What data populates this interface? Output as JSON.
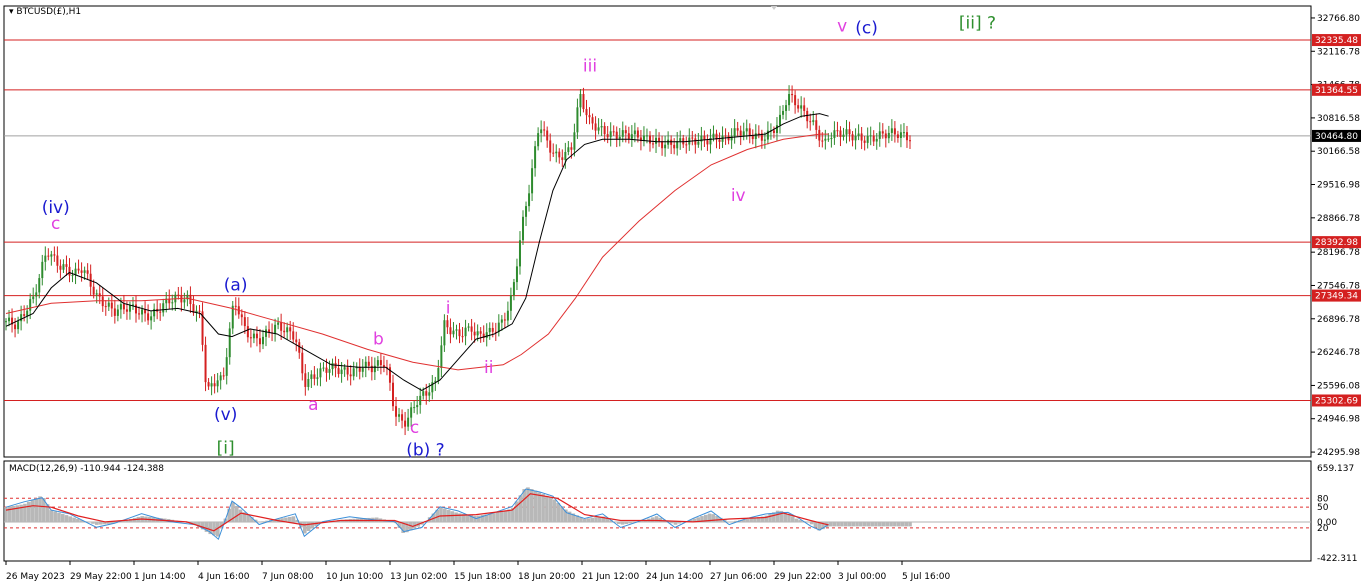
{
  "symbol": "BTCUSD(£),H1",
  "macd_label": "MACD(12,26,9) -110.944 -124.388",
  "colors": {
    "bull_candle": "#2e8b2e",
    "bear_candle": "#d42020",
    "ma_fast": "#000000",
    "ma_slow": "#e03030",
    "hline": "#d42020",
    "current": "#a0a0a0",
    "macd_hist": "#b8b8b8",
    "macd_line": "#3b8fd9",
    "macd_signal": "#e02020",
    "magenta": "#e040e0",
    "blue": "#1a1ad0",
    "green": "#2d8f2d"
  },
  "chart_data": [
    {
      "type": "line",
      "title": "BTCUSD(£),H1",
      "ylim": [
        24200,
        33000
      ],
      "price_ticks": [
        "32766.80",
        "32116.78",
        "31466.78",
        "30816.58",
        "30166.58",
        "29516.98",
        "28866.78",
        "28196.78",
        "27546.78",
        "26896.78",
        "26246.78",
        "25596.08",
        "24946.98",
        "24295.98"
      ],
      "x_ticks": [
        "26 May 2023",
        "29 May 22:00",
        "1 Jun 14:00",
        "4 Jun 16:00",
        "7 Jun 08:00",
        "10 Jun 10:00",
        "13 Jun 02:00",
        "15 Jun 18:00",
        "18 Jun 20:00",
        "21 Jun 12:00",
        "24 Jun 14:00",
        "27 Jun 06:00",
        "29 Jun 22:00",
        "3 Jul 00:00",
        "5 Jul 16:00"
      ],
      "hlines": [
        {
          "label": "32335.48",
          "value": 32335.48
        },
        {
          "label": "31364.55",
          "value": 31364.55
        },
        {
          "label": "28392.98",
          "value": 28392.98
        },
        {
          "label": "27349.34",
          "value": 27349.34
        },
        {
          "label": "25302.69",
          "value": 25302.69
        }
      ],
      "current": {
        "label": "30464.80",
        "value": 30464.8
      },
      "path_points": [
        [
          0,
          26850
        ],
        [
          0.012,
          26700
        ],
        [
          0.03,
          27300
        ],
        [
          0.045,
          28300
        ],
        [
          0.06,
          27900
        ],
        [
          0.075,
          27700
        ],
        [
          0.085,
          27900
        ],
        [
          0.1,
          27400
        ],
        [
          0.12,
          27000
        ],
        [
          0.14,
          27100
        ],
        [
          0.16,
          27000
        ],
        [
          0.18,
          27200
        ],
        [
          0.2,
          27300
        ],
        [
          0.215,
          27000
        ],
        [
          0.222,
          25500
        ],
        [
          0.235,
          25700
        ],
        [
          0.24,
          25600
        ],
        [
          0.25,
          27000
        ],
        [
          0.255,
          27200
        ],
        [
          0.265,
          26700
        ],
        [
          0.28,
          26500
        ],
        [
          0.3,
          26700
        ],
        [
          0.32,
          26600
        ],
        [
          0.33,
          25700
        ],
        [
          0.345,
          25800
        ],
        [
          0.36,
          25900
        ],
        [
          0.38,
          25900
        ],
        [
          0.395,
          26000
        ],
        [
          0.405,
          25900
        ],
        [
          0.42,
          26000
        ],
        [
          0.43,
          25100
        ],
        [
          0.44,
          24900
        ],
        [
          0.455,
          25300
        ],
        [
          0.465,
          25400
        ],
        [
          0.475,
          25600
        ],
        [
          0.485,
          26800
        ],
        [
          0.5,
          26650
        ],
        [
          0.515,
          26700
        ],
        [
          0.52,
          26500
        ],
        [
          0.535,
          26600
        ],
        [
          0.55,
          26900
        ],
        [
          0.56,
          27400
        ],
        [
          0.57,
          28600
        ],
        [
          0.58,
          29500
        ],
        [
          0.59,
          30700
        ],
        [
          0.6,
          30300
        ],
        [
          0.61,
          30100
        ],
        [
          0.625,
          30200
        ],
        [
          0.635,
          31200
        ],
        [
          0.645,
          30700
        ],
        [
          0.66,
          30600
        ],
        [
          0.68,
          30500
        ],
        [
          0.7,
          30400
        ],
        [
          0.72,
          30400
        ],
        [
          0.74,
          30300
        ],
        [
          0.755,
          30300
        ],
        [
          0.77,
          30400
        ],
        [
          0.785,
          30500
        ],
        [
          0.795,
          30400
        ],
        [
          0.81,
          30500
        ],
        [
          0.825,
          30500
        ],
        [
          0.84,
          30500
        ],
        [
          0.855,
          30700
        ],
        [
          0.865,
          31200
        ],
        [
          0.875,
          31050
        ],
        [
          0.885,
          30900
        ],
        [
          0.895,
          30700
        ],
        [
          0.905,
          30300
        ],
        [
          0.91,
          30464
        ]
      ],
      "ma_fast": [
        [
          0,
          26750
        ],
        [
          0.03,
          27000
        ],
        [
          0.05,
          27500
        ],
        [
          0.07,
          27800
        ],
        [
          0.1,
          27600
        ],
        [
          0.13,
          27200
        ],
        [
          0.16,
          27050
        ],
        [
          0.19,
          27100
        ],
        [
          0.215,
          27000
        ],
        [
          0.235,
          26600
        ],
        [
          0.25,
          26550
        ],
        [
          0.27,
          26700
        ],
        [
          0.3,
          26600
        ],
        [
          0.33,
          26300
        ],
        [
          0.36,
          26000
        ],
        [
          0.39,
          25950
        ],
        [
          0.42,
          25950
        ],
        [
          0.44,
          25700
        ],
        [
          0.46,
          25500
        ],
        [
          0.48,
          25700
        ],
        [
          0.5,
          26100
        ],
        [
          0.52,
          26500
        ],
        [
          0.54,
          26600
        ],
        [
          0.56,
          26800
        ],
        [
          0.575,
          27300
        ],
        [
          0.59,
          28400
        ],
        [
          0.605,
          29400
        ],
        [
          0.62,
          30000
        ],
        [
          0.64,
          30300
        ],
        [
          0.66,
          30400
        ],
        [
          0.69,
          30400
        ],
        [
          0.72,
          30350
        ],
        [
          0.75,
          30350
        ],
        [
          0.78,
          30400
        ],
        [
          0.81,
          30450
        ],
        [
          0.84,
          30500
        ],
        [
          0.86,
          30700
        ],
        [
          0.88,
          30850
        ],
        [
          0.9,
          30900
        ],
        [
          0.91,
          30850
        ]
      ],
      "ma_slow": [
        [
          0,
          27000
        ],
        [
          0.05,
          27200
        ],
        [
          0.1,
          27250
        ],
        [
          0.15,
          27250
        ],
        [
          0.2,
          27300
        ],
        [
          0.25,
          27100
        ],
        [
          0.3,
          26850
        ],
        [
          0.35,
          26600
        ],
        [
          0.4,
          26300
        ],
        [
          0.45,
          26050
        ],
        [
          0.5,
          25900
        ],
        [
          0.55,
          26000
        ],
        [
          0.57,
          26200
        ],
        [
          0.6,
          26600
        ],
        [
          0.63,
          27300
        ],
        [
          0.66,
          28100
        ],
        [
          0.7,
          28800
        ],
        [
          0.74,
          29400
        ],
        [
          0.78,
          29900
        ],
        [
          0.82,
          30200
        ],
        [
          0.86,
          30400
        ],
        [
          0.9,
          30500
        ],
        [
          0.91,
          30500
        ]
      ],
      "labels": [
        {
          "text": "(iv)",
          "x": 0.055,
          "v": 28960,
          "color": "blue"
        },
        {
          "text": "c",
          "x": 0.055,
          "v": 28650,
          "color": "magenta"
        },
        {
          "text": "(a)",
          "x": 0.254,
          "v": 27450,
          "color": "blue"
        },
        {
          "text": "(v)",
          "x": 0.243,
          "v": 24920,
          "color": "blue"
        },
        {
          "text": "[i]",
          "x": 0.243,
          "v": 24270,
          "color": "green"
        },
        {
          "text": "a",
          "x": 0.34,
          "v": 25120,
          "color": "magenta"
        },
        {
          "text": "b",
          "x": 0.412,
          "v": 26400,
          "color": "magenta"
        },
        {
          "text": "c",
          "x": 0.452,
          "v": 24670,
          "color": "magenta"
        },
        {
          "text": "(b) ?",
          "x": 0.464,
          "v": 24230,
          "color": "blue"
        },
        {
          "text": "i",
          "x": 0.489,
          "v": 27000,
          "color": "magenta"
        },
        {
          "text": "ii",
          "x": 0.534,
          "v": 25840,
          "color": "magenta"
        },
        {
          "text": "iii",
          "x": 0.646,
          "v": 31720,
          "color": "magenta"
        },
        {
          "text": "iv",
          "x": 0.81,
          "v": 29200,
          "color": "magenta"
        },
        {
          "text": "v",
          "x": 0.925,
          "v": 32500,
          "color": "magenta"
        },
        {
          "text": "(c)",
          "x": 0.952,
          "v": 32460,
          "color": "blue"
        },
        {
          "text": "[ii] ?",
          "x": 1.0,
          "v": 32560,
          "color": "green"
        }
      ]
    },
    {
      "type": "line",
      "title": "MACD(12,26,9) -110.944 -124.388",
      "ylim": [
        -422.311,
        659.137
      ],
      "ticks": [
        "659.137",
        "80",
        "50",
        "0.00",
        "20",
        "-422.311"
      ],
      "levels": [
        80,
        50,
        0,
        -20
      ],
      "macd_line": [
        [
          0,
          50
        ],
        [
          0.02,
          60
        ],
        [
          0.04,
          90
        ],
        [
          0.05,
          40
        ],
        [
          0.07,
          20
        ],
        [
          0.1,
          -10
        ],
        [
          0.12,
          -5
        ],
        [
          0.15,
          20
        ],
        [
          0.18,
          10
        ],
        [
          0.21,
          -10
        ],
        [
          0.225,
          -40
        ],
        [
          0.235,
          -50
        ],
        [
          0.25,
          70
        ],
        [
          0.26,
          40
        ],
        [
          0.28,
          0
        ],
        [
          0.3,
          10
        ],
        [
          0.32,
          20
        ],
        [
          0.33,
          -40
        ],
        [
          0.35,
          0
        ],
        [
          0.38,
          10
        ],
        [
          0.41,
          15
        ],
        [
          0.43,
          0
        ],
        [
          0.44,
          -40
        ],
        [
          0.46,
          -10
        ],
        [
          0.48,
          50
        ],
        [
          0.5,
          30
        ],
        [
          0.52,
          20
        ],
        [
          0.54,
          30
        ],
        [
          0.56,
          45
        ],
        [
          0.575,
          120
        ],
        [
          0.59,
          100
        ],
        [
          0.605,
          80
        ],
        [
          0.62,
          40
        ],
        [
          0.64,
          10
        ],
        [
          0.66,
          20
        ],
        [
          0.68,
          -10
        ],
        [
          0.7,
          0
        ],
        [
          0.72,
          20
        ],
        [
          0.74,
          -10
        ],
        [
          0.76,
          10
        ],
        [
          0.78,
          30
        ],
        [
          0.8,
          0
        ],
        [
          0.82,
          10
        ],
        [
          0.84,
          20
        ],
        [
          0.855,
          40
        ],
        [
          0.865,
          30
        ],
        [
          0.875,
          10
        ],
        [
          0.89,
          -5
        ],
        [
          0.9,
          -30
        ],
        [
          0.91,
          -15
        ]
      ],
      "macd_signal": [
        [
          0,
          40
        ],
        [
          0.03,
          55
        ],
        [
          0.05,
          50
        ],
        [
          0.08,
          20
        ],
        [
          0.11,
          0
        ],
        [
          0.15,
          10
        ],
        [
          0.2,
          0
        ],
        [
          0.23,
          -30
        ],
        [
          0.26,
          30
        ],
        [
          0.3,
          5
        ],
        [
          0.33,
          -10
        ],
        [
          0.37,
          5
        ],
        [
          0.43,
          5
        ],
        [
          0.45,
          -15
        ],
        [
          0.48,
          20
        ],
        [
          0.52,
          25
        ],
        [
          0.56,
          40
        ],
        [
          0.58,
          95
        ],
        [
          0.61,
          80
        ],
        [
          0.64,
          25
        ],
        [
          0.68,
          5
        ],
        [
          0.72,
          5
        ],
        [
          0.76,
          0
        ],
        [
          0.8,
          10
        ],
        [
          0.84,
          15
        ],
        [
          0.86,
          30
        ],
        [
          0.89,
          5
        ],
        [
          0.91,
          -10
        ]
      ]
    }
  ]
}
